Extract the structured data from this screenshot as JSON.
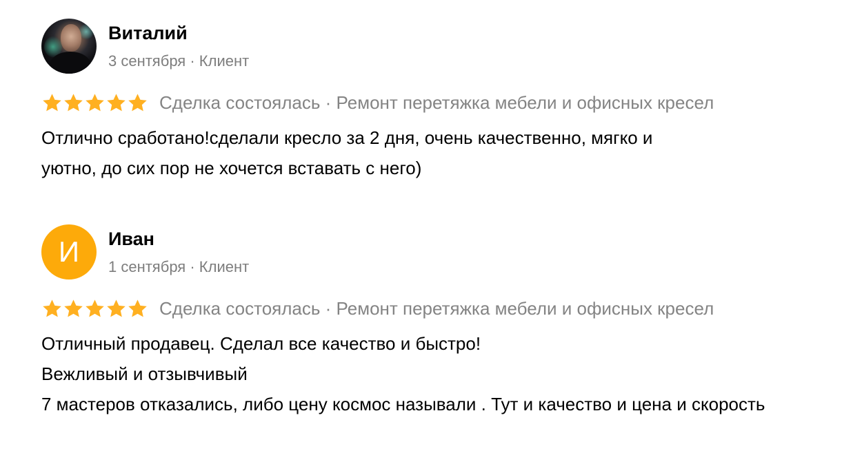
{
  "colors": {
    "star": "#ffb021",
    "avatar_letter_bg": "#fdaa0a",
    "muted_text": "#848484"
  },
  "reviews": [
    {
      "author": "Виталий",
      "date": "3 сентября",
      "separator": " · ",
      "role": "Клиент",
      "avatar_type": "photo",
      "rating": 5,
      "deal": "Сделка состоялась · Ремонт перетяжка мебели и офисных кресел",
      "text_lines": [
        "Отлично сработано!сделали кресло за 2 дня, очень качественно, мягко и",
        "уютно, до сих пор не хочется вставать с него)"
      ]
    },
    {
      "author": "Иван",
      "avatar_letter": "И",
      "date": "1 сентября",
      "separator": " · ",
      "role": "Клиент",
      "avatar_type": "letter",
      "rating": 5,
      "deal": "Сделка состоялась · Ремонт перетяжка мебели и офисных кресел",
      "text_lines": [
        "Отличный продавец. Сделал все качество и быстро!",
        "Вежливый и отзывчивый",
        "7 мастеров отказались, либо цену космос называли . Тут и качество и цена и скорость"
      ]
    }
  ]
}
